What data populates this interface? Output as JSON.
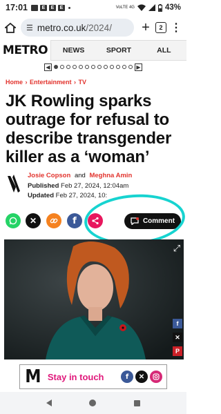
{
  "status": {
    "time": "17:01",
    "notif_icons": [
      "E",
      "E",
      "E"
    ],
    "network": "VoLTE 4G",
    "battery": "43%"
  },
  "browser": {
    "url_host": "metro.co.uk",
    "url_path": "/2024/",
    "tab_count": "2"
  },
  "site": {
    "logo": "METRO",
    "nav": [
      "NEWS",
      "SPORT",
      "ALL"
    ]
  },
  "breadcrumb": [
    "Home",
    "Entertainment",
    "TV"
  ],
  "article": {
    "headline": "JK Rowling sparks outrage for refusal to describe transgender killer as a ‘woman’",
    "author1": "Josie Copson",
    "and": "and",
    "author2": "Meghna Amin",
    "published_label": "Published",
    "published_value": "Feb 27, 2024, 12:04am",
    "updated_label": "Updated",
    "updated_value": "Feb 27, 2024, 10:"
  },
  "share": {
    "comment_label": "Comment"
  },
  "promo": {
    "logo_letter": "M",
    "text": "Stay in touch"
  },
  "colors": {
    "accent": "#e2332d",
    "highlight": "#17d3d0",
    "pink": "#e0187b",
    "whatsapp": "#25d366",
    "x": "#111111",
    "link": "#f58220",
    "facebook": "#3b5998",
    "share": "#e8175d"
  }
}
